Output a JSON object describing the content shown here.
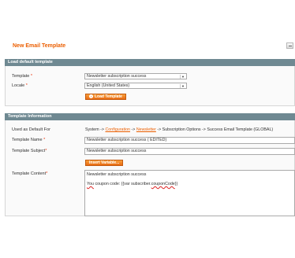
{
  "page": {
    "title": "New Email Template"
  },
  "load_default": {
    "header": "Load default template",
    "template_label": "Template",
    "template_value": "Newsletter subscription success",
    "locale_label": "Locale",
    "locale_value": "English (United States)",
    "load_button": "Load Template"
  },
  "info": {
    "header": "Template Information",
    "used_as_default_label": "Used as Default For",
    "path_prefix": "System ->",
    "path_link1": "Configuration",
    "path_sep1": "->",
    "path_link2": "Newsletter",
    "path_suffix": "-> Subscription Options -> Success Email Template  (GLOBAL)",
    "name_label": "Template Name",
    "name_value": "Newsletter subscription success ( EDITED)",
    "subject_label": "Template Subject",
    "subject_value": "Newsletter subscription success",
    "insert_variable_button": "Insert Variable...",
    "content_label": "Template Content",
    "content_line1": "Newsletter subscription success",
    "content_word_you": "You",
    "content_mid": "coupo",
    "content_rest": "n code: {{var subscriber.",
    "content_coupon": "couponCode",
    "content_end": "}}"
  },
  "required_mark": "*"
}
